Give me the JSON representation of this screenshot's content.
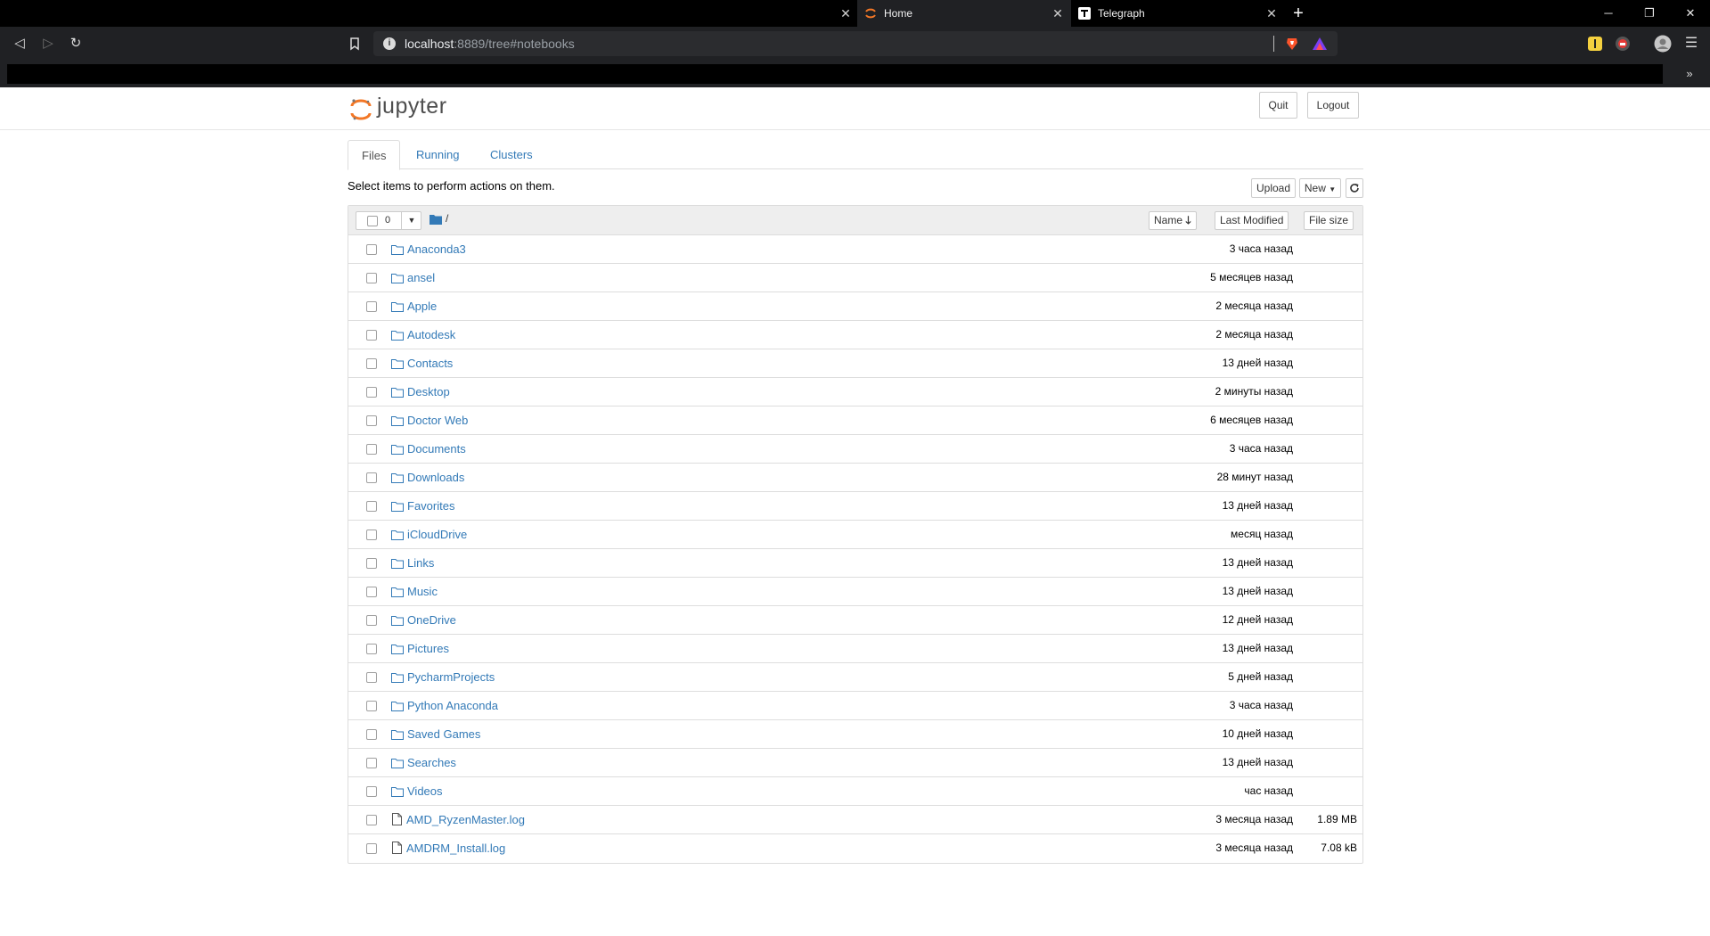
{
  "browser": {
    "tabs": [
      {
        "title": "Home",
        "active": true,
        "icon": "jupyter-icon"
      },
      {
        "title": "Telegraph",
        "active": false,
        "icon": "telegraph-icon"
      }
    ],
    "close_glyph": "✕",
    "new_tab_glyph": "+",
    "window_controls": {
      "minimize": "─",
      "restore": "❐",
      "close": "✕"
    },
    "nav": {
      "back": "◁",
      "forward": "▷",
      "reload": "↻",
      "menu": "☰",
      "more": "»"
    },
    "url": {
      "host": "localhost",
      "rest": ":8889/tree#notebooks"
    },
    "colors": {
      "chrome_bg": "#202124",
      "tabstrip_bg": "#000000",
      "brave_orange": "#fb542b"
    }
  },
  "header": {
    "logo_text": "jupyter",
    "quit_label": "Quit",
    "logout_label": "Logout"
  },
  "tabs": [
    {
      "label": "Files",
      "active": true
    },
    {
      "label": "Running",
      "active": false
    },
    {
      "label": "Clusters",
      "active": false
    }
  ],
  "hint": "Select items to perform actions on them.",
  "actions": {
    "upload_label": "Upload",
    "new_label": "New",
    "refresh_icon": "refresh-icon"
  },
  "list_header": {
    "selected_count": "0",
    "breadcrumb": "/",
    "name_label": "Name",
    "last_modified_label": "Last Modified",
    "file_size_label": "File size"
  },
  "files": [
    {
      "name": "Anaconda3",
      "type": "folder",
      "modified": "3 часа назад",
      "size": ""
    },
    {
      "name": "ansel",
      "type": "folder",
      "modified": "5 месяцев назад",
      "size": ""
    },
    {
      "name": "Apple",
      "type": "folder",
      "modified": "2 месяца назад",
      "size": ""
    },
    {
      "name": "Autodesk",
      "type": "folder",
      "modified": "2 месяца назад",
      "size": ""
    },
    {
      "name": "Contacts",
      "type": "folder",
      "modified": "13 дней назад",
      "size": ""
    },
    {
      "name": "Desktop",
      "type": "folder",
      "modified": "2 минуты назад",
      "size": ""
    },
    {
      "name": "Doctor Web",
      "type": "folder",
      "modified": "6 месяцев назад",
      "size": ""
    },
    {
      "name": "Documents",
      "type": "folder",
      "modified": "3 часа назад",
      "size": ""
    },
    {
      "name": "Downloads",
      "type": "folder",
      "modified": "28 минут назад",
      "size": ""
    },
    {
      "name": "Favorites",
      "type": "folder",
      "modified": "13 дней назад",
      "size": ""
    },
    {
      "name": "iCloudDrive",
      "type": "folder",
      "modified": "месяц назад",
      "size": ""
    },
    {
      "name": "Links",
      "type": "folder",
      "modified": "13 дней назад",
      "size": ""
    },
    {
      "name": "Music",
      "type": "folder",
      "modified": "13 дней назад",
      "size": ""
    },
    {
      "name": "OneDrive",
      "type": "folder",
      "modified": "12 дней назад",
      "size": ""
    },
    {
      "name": "Pictures",
      "type": "folder",
      "modified": "13 дней назад",
      "size": ""
    },
    {
      "name": "PycharmProjects",
      "type": "folder",
      "modified": "5 дней назад",
      "size": ""
    },
    {
      "name": "Python Anaconda",
      "type": "folder",
      "modified": "3 часа назад",
      "size": ""
    },
    {
      "name": "Saved Games",
      "type": "folder",
      "modified": "10 дней назад",
      "size": ""
    },
    {
      "name": "Searches",
      "type": "folder",
      "modified": "13 дней назад",
      "size": ""
    },
    {
      "name": "Videos",
      "type": "folder",
      "modified": "час назад",
      "size": ""
    },
    {
      "name": "AMD_RyzenMaster.log",
      "type": "file",
      "modified": "3 месяца назад",
      "size": "1.89 MB"
    },
    {
      "name": "AMDRM_Install.log",
      "type": "file",
      "modified": "3 месяца назад",
      "size": "7.08 kB"
    }
  ],
  "colors": {
    "link": "#337ab7",
    "jupyter_orange": "#f37726"
  }
}
